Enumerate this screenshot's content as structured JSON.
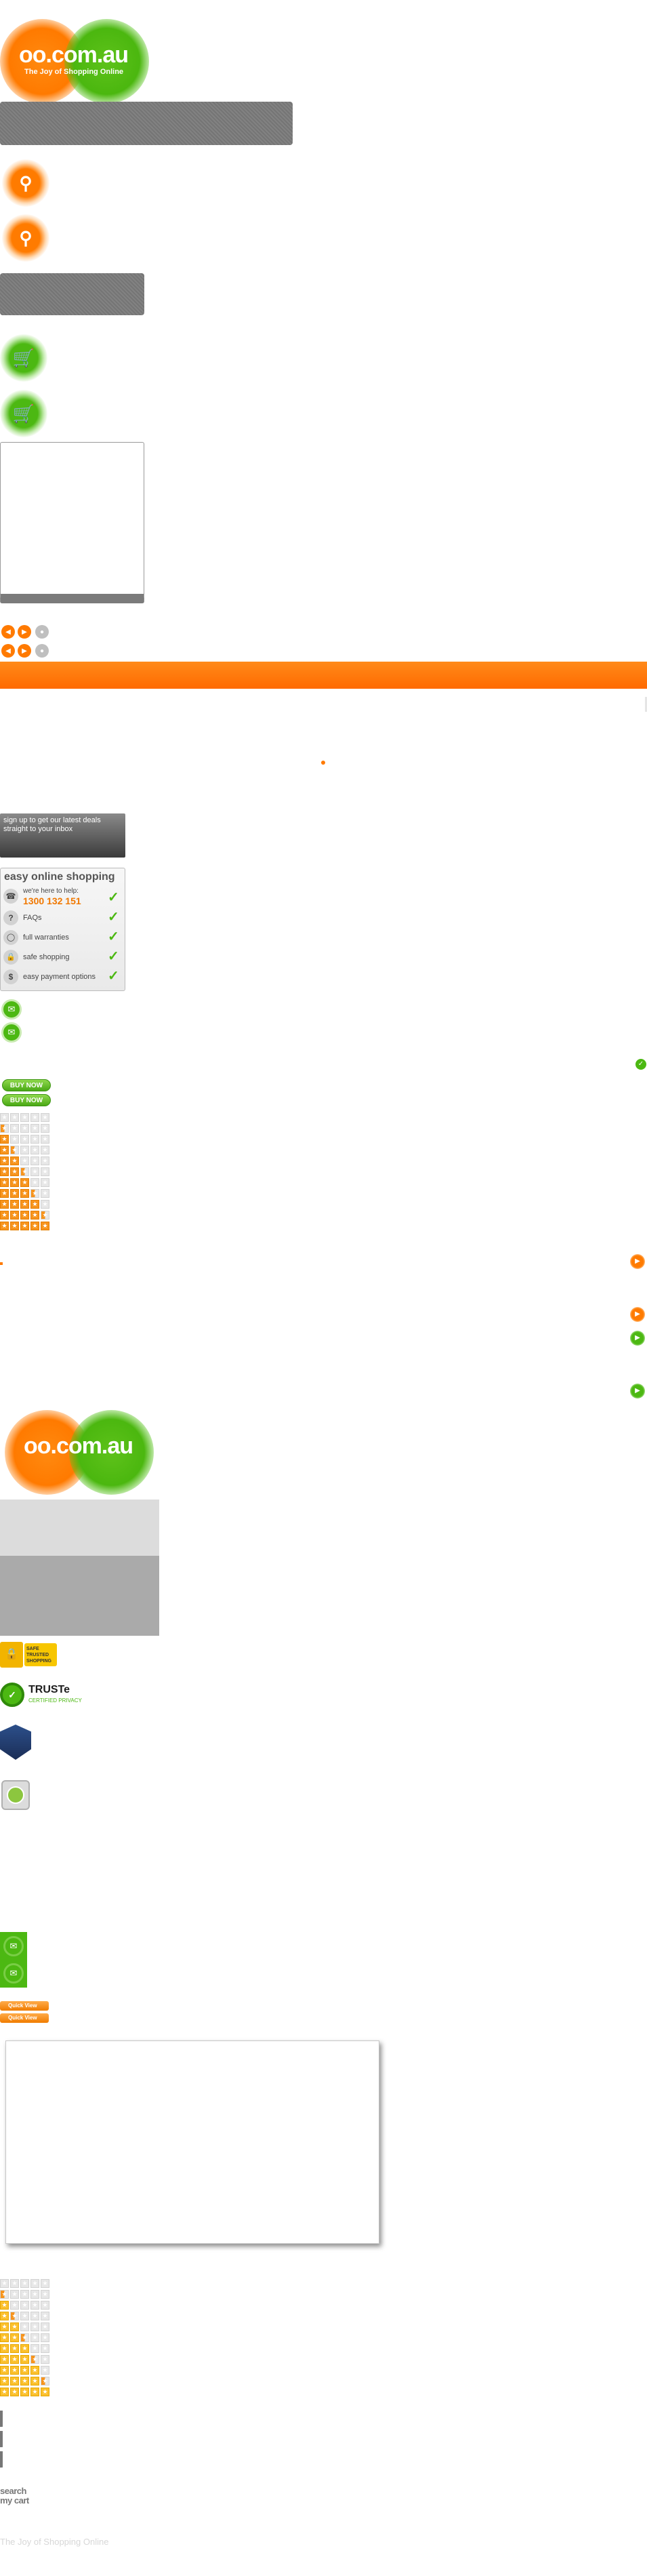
{
  "logo": {
    "main": "oo.com.au",
    "tagline": "The Joy of Shopping Online"
  },
  "icons": {
    "search": "search-icon",
    "cart": "cart-icon",
    "phone": "phone-icon",
    "question": "question-icon",
    "shield": "shield-icon",
    "lock": "lock-icon",
    "dollar": "dollar-icon",
    "check": "checkmark-icon",
    "envelope": "envelope-icon",
    "arrow": "arrow-right-icon"
  },
  "newsletter": {
    "text": "sign up to get our latest deals straight to your inbox"
  },
  "easy_shopping": {
    "title": "easy online shopping",
    "help_label": "we're here to help:",
    "phone": "1300 132 151",
    "items": [
      "FAQs",
      "full warranties",
      "safe shopping",
      "easy payment options"
    ]
  },
  "buttons": {
    "buy_now": "BUY NOW",
    "quick_view": "Quick View"
  },
  "trust": {
    "safe_label": "SAFE TRUSTED SHOPPING",
    "truste": "TRUSTe",
    "truste_sub": "CERTIFIED PRIVACY"
  },
  "sprite_text": {
    "search": "search",
    "my_cart": "my cart",
    "footer_tagline": "The Joy of Shopping Online"
  },
  "colors": {
    "orange": "#ff7b00",
    "green": "#4cb812",
    "grey": "#7b7b7b"
  }
}
